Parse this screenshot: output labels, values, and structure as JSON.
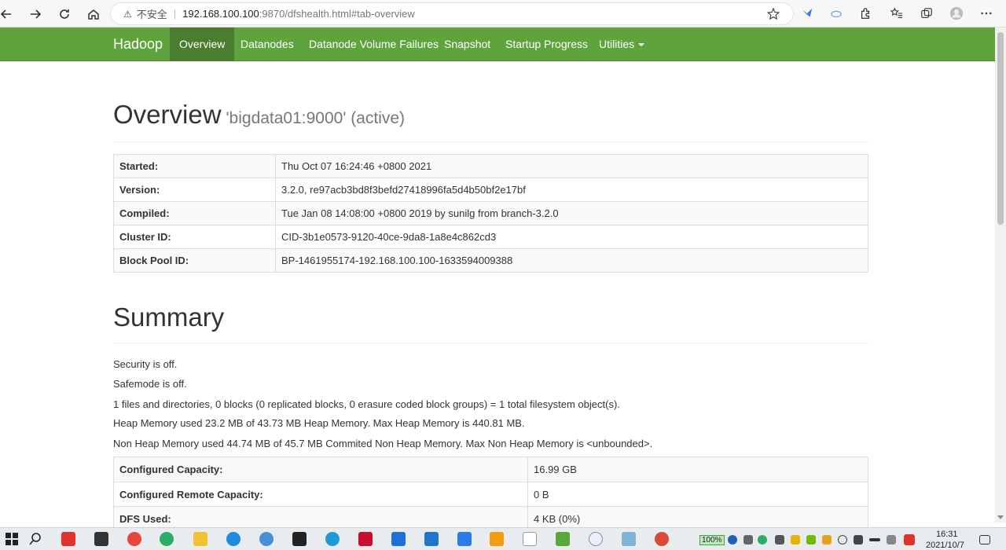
{
  "browser": {
    "insecure_label": "不安全",
    "separator": "|",
    "url_host": "192.168.100.100",
    "url_rest": ":9870/dfshealth.html#tab-overview"
  },
  "navbar": {
    "brand": "Hadoop",
    "items": [
      {
        "label": "Overview",
        "active": true
      },
      {
        "label": "Datanodes"
      },
      {
        "label": "Datanode Volume Failures"
      },
      {
        "label": "Snapshot"
      },
      {
        "label": "Startup Progress"
      },
      {
        "label": "Utilities"
      }
    ]
  },
  "overview": {
    "title": "Overview",
    "subtitle": "'bigdata01:9000' (active)",
    "rows": [
      {
        "key": "Started:",
        "value": "Thu Oct 07 16:24:46 +0800 2021"
      },
      {
        "key": "Version:",
        "value": "3.2.0, re97acb3bd8f3befd27418996fa5d4b50bf2e17bf"
      },
      {
        "key": "Compiled:",
        "value": "Tue Jan 08 14:08:00 +0800 2019 by sunilg from branch-3.2.0"
      },
      {
        "key": "Cluster ID:",
        "value": "CID-3b1e0573-9120-40ce-9da8-1a8e4c862cd3"
      },
      {
        "key": "Block Pool ID:",
        "value": "BP-1461955174-192.168.100.100-1633594009388"
      }
    ]
  },
  "summary": {
    "title": "Summary",
    "lines": [
      "Security is off.",
      "Safemode is off.",
      "1 files and directories, 0 blocks (0 replicated blocks, 0 erasure coded block groups) = 1 total filesystem object(s).",
      "Heap Memory used 23.2 MB of 43.73 MB Heap Memory. Max Heap Memory is 440.81 MB.",
      "Non Heap Memory used 44.74 MB of 45.7 MB Commited Non Heap Memory. Max Non Heap Memory is <unbounded>."
    ],
    "rows": [
      {
        "key": "Configured Capacity:",
        "value": "16.99 GB"
      },
      {
        "key": "Configured Remote Capacity:",
        "value": "0 B"
      },
      {
        "key": "DFS Used:",
        "value": "4 KB (0%)"
      }
    ]
  },
  "taskbar": {
    "battery": "100%",
    "time": "16:31",
    "date": "2021/10/7"
  }
}
